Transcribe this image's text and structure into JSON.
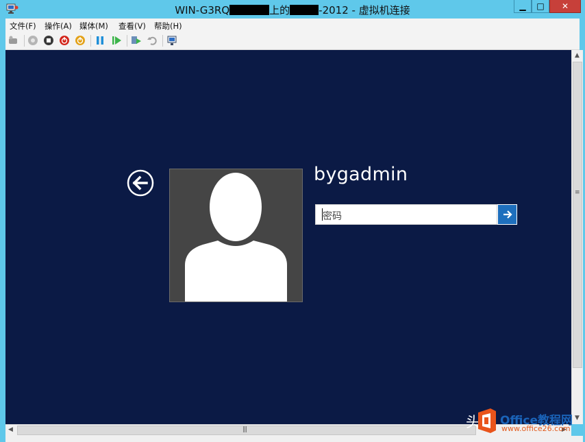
{
  "window": {
    "title_prefix": "WIN-G3RQ",
    "title_mid": "上的",
    "title_suffix": "-2012 - 虚拟机连接",
    "controls": {
      "minimize": "▁",
      "maximize": "□",
      "close": "✕"
    }
  },
  "menu": [
    {
      "label": "文件(F)"
    },
    {
      "label": "操作(A)"
    },
    {
      "label": "媒体(M)"
    },
    {
      "label": "查看(V)"
    },
    {
      "label": "帮助(H)"
    }
  ],
  "toolbar": {
    "icons": [
      "ctrl-alt-del-icon",
      "start-icon",
      "turn-off-icon",
      "shutdown-icon",
      "save-icon",
      "pause-icon",
      "resume-icon",
      "checkpoint-icon",
      "revert-icon",
      "enhanced-session-icon"
    ]
  },
  "login": {
    "username": "bygadmin",
    "password_placeholder": "密码"
  },
  "watermark": {
    "left_text": "头",
    "brand": "Office教程网",
    "url": "www.office26.com"
  },
  "colors": {
    "titlebar": "#5fc8ea",
    "screen_bg": "#0b1a45",
    "accent": "#1e6fbd"
  }
}
